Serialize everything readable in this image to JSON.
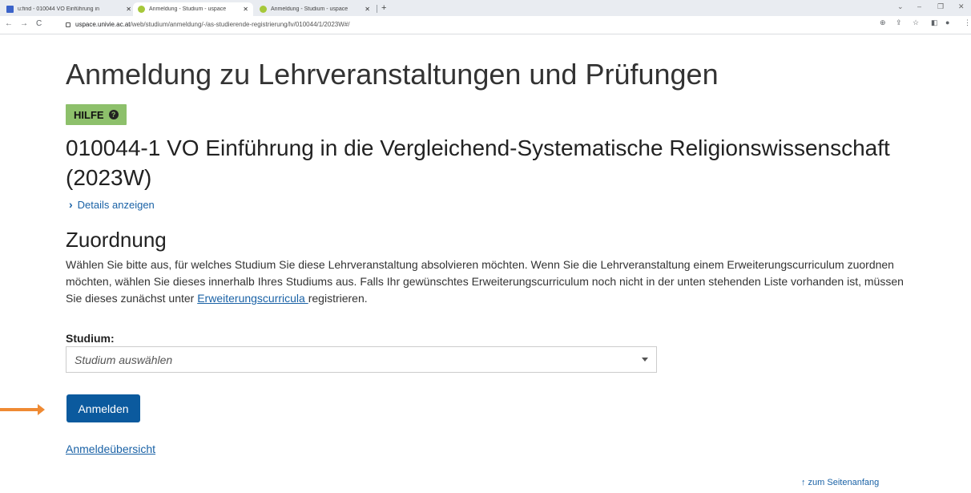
{
  "browser": {
    "tabs": [
      {
        "title": "u:find - 010044 VO Einführung in"
      },
      {
        "title": "Anmeldung - Studium - uspace"
      },
      {
        "title": "Anmeldung - Studium - uspace"
      }
    ],
    "url_host": "uspace.univie.ac.at",
    "url_path": "/web/studium/anmeldung/-/as-studierende-registrierung/lv/010044/1/2023W#/"
  },
  "page": {
    "title": "Anmeldung zu Lehrveranstaltungen und Prüfungen",
    "help_label": "HILFE",
    "course_title": "010044-1 VO Einführung in die Vergleichend-Systematische Religionswissenschaft (2023W)",
    "details_link": "Details anzeigen",
    "section_title": "Zuordnung",
    "description_before": "Wählen Sie bitte aus, für welches Studium Sie diese Lehrveranstaltung absolvieren möchten. Wenn Sie die Lehrveranstaltung einem Erweiterungscurriculum zuordnen möchten, wählen Sie dieses innerhalb Ihres Studiums aus. Falls Ihr gewünschtes Erweiterungscurriculum noch nicht in der unten stehenden Liste vorhanden ist, müssen Sie dieses zunächst unter ",
    "description_link": "Erweiterungscurricula ",
    "description_after": "registrieren.",
    "field_label": "Studium:",
    "select_placeholder": "Studium auswählen",
    "submit_label": "Anmelden",
    "overview_link": "Anmeldeübersicht",
    "back_to_top": "↑ zum Seitenanfang"
  },
  "colors": {
    "help_badge": "#8dc06b",
    "button": "#0b5a9e",
    "link": "#1a62a6",
    "annotation_arrow": "#ef8a33"
  }
}
